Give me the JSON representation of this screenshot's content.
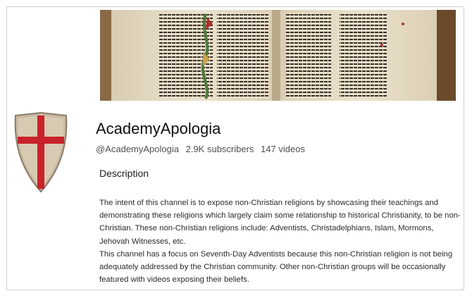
{
  "channel": {
    "name": "AcademyApologia",
    "handle": "@AcademyApologia",
    "subscribers": "2.9K subscribers",
    "videos": "147 videos"
  },
  "description": {
    "heading": "Description",
    "paragraph_1": "The intent of this channel is to expose non-Christian religions by showcasing their teachings and demonstrating these religions which largely claim some relationship to historical Christianity, to be non-Christian. These non-Christian religions include: Adventists, Christadelphians, Islam, Mormons, Jehovah Witnesses, etc.",
    "paragraph_2": "This channel has a focus on Seventh-Day Adventists because this non-Christian religion is not being adequately addressed by the Christian community.  Other non-Christian groups will be occasionally featured with videos exposing their beliefs."
  },
  "images": {
    "banner": "open-manuscript-bible-banner",
    "avatar": "crusader-shield-red-cross-icon"
  },
  "colors": {
    "shield_fill": "#c9b9a3",
    "cross": "#c8222a",
    "parchment": "#e6dcc6",
    "text_primary": "#0f0f0f",
    "text_secondary": "#505050"
  }
}
